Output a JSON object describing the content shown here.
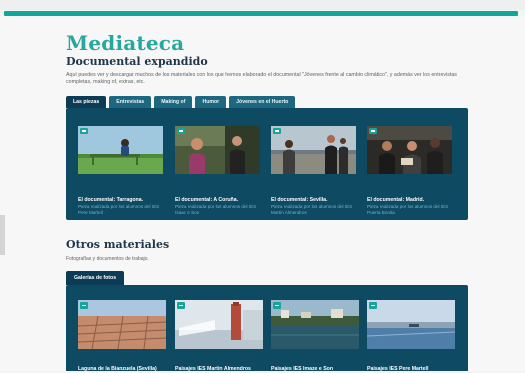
{
  "header": {
    "brand": "Mediateca"
  },
  "section1": {
    "title": "Documental expandido",
    "description": "Aquí puedes ver y descargar muchos de los materiales con los que hemos elaborado el documental \"Jóvenes frente al cambio climático\", y además ver los entrevistas completas, making of, extras, etc.",
    "tabs": [
      {
        "label": "Las piezas"
      },
      {
        "label": "Entrevistas"
      },
      {
        "label": "Making of"
      },
      {
        "label": "Humor"
      },
      {
        "label": "Jóvenes en el Huerto"
      }
    ],
    "cards": [
      {
        "title": "El documental: Tarragona.",
        "subtitle": "Pieza realizada por los alumnos del IES Pere Martell"
      },
      {
        "title": "El documental: A Coruña.",
        "subtitle": "Pieza realizada por los alumnos del IES Isaac e Son"
      },
      {
        "title": "El documental: Sevilla.",
        "subtitle": "Pieza realizada por los alumnos del IES Martin Almendros"
      },
      {
        "title": "El documental: Madrid.",
        "subtitle": "Pieza realizada por los alumnos del IES Puerta Bonita"
      }
    ]
  },
  "section2": {
    "title": "Otros materiales",
    "description": "Fotografías y documentos de trabajo.",
    "tab": "Galerías de fotos",
    "cards": [
      {
        "title": "Laguna de la Bianzuela (Sevilla)"
      },
      {
        "title": "Paisajes IES Martin Almendros"
      },
      {
        "title": "Paisajes IES Imaze e Son"
      },
      {
        "title": "Paisajes IES Pere Martell"
      }
    ]
  },
  "icons": {
    "video": "video-camera-icon",
    "image": "image-icon"
  },
  "colors": {
    "accent": "#12a79b",
    "panel": "#0f4a63",
    "tab_active": "#0c3b56"
  }
}
